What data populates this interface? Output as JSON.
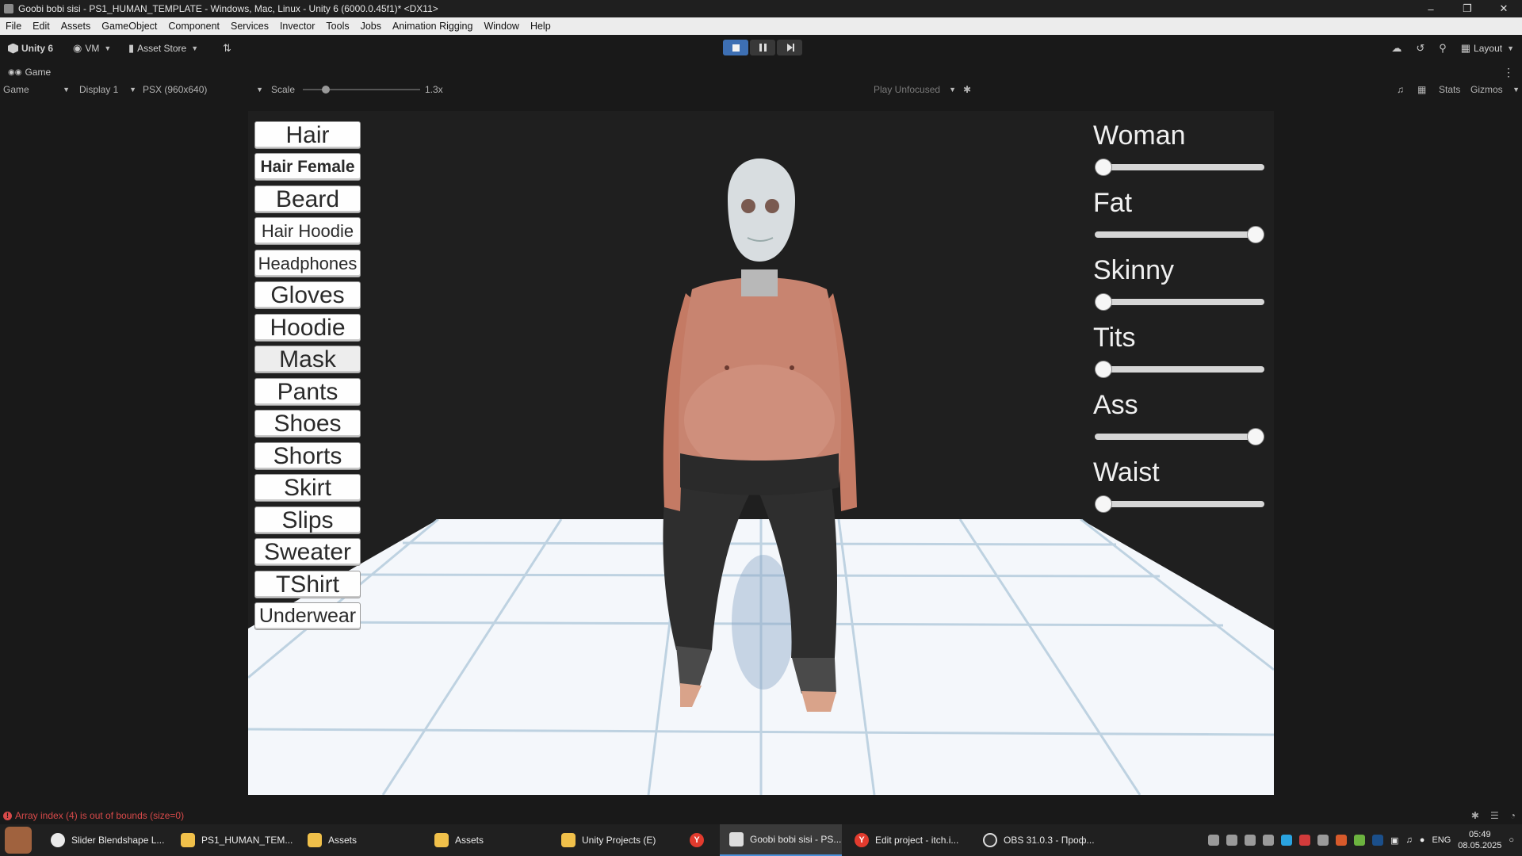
{
  "window": {
    "title": "Goobi bobi sisi - PS1_HUMAN_TEMPLATE - Windows, Mac, Linux - Unity 6 (6000.0.45f1)* <DX11>",
    "controls": [
      "–",
      "❐",
      "✕"
    ]
  },
  "menu": [
    "File",
    "Edit",
    "Assets",
    "GameObject",
    "Component",
    "Services",
    "Invector",
    "Tools",
    "Jobs",
    "Animation Rigging",
    "Window",
    "Help"
  ],
  "toolbar": {
    "unity_label": "Unity 6",
    "account": "VM",
    "asset_store": "Asset Store",
    "layout": "Layout",
    "play_state": "playing"
  },
  "game_tab": {
    "label": "Game"
  },
  "game_bar": {
    "view": "Game",
    "display": "Display 1",
    "resolution": "PSX (960x640)",
    "scale_label": "Scale",
    "scale_value": "1.3x",
    "play_mode": "Play Unfocused",
    "stats": "Stats",
    "gizmos": "Gizmos"
  },
  "clothing_buttons": [
    "Hair",
    "Hair Female",
    "Beard",
    "Hair Hoodie",
    "Headphones",
    "Gloves",
    "Hoodie",
    "Mask",
    "Pants",
    "Shoes",
    "Shorts",
    "Skirt",
    "Slips",
    "Sweater",
    "TShirt",
    "Underwear"
  ],
  "blendshape_sliders": [
    {
      "label": "Woman",
      "value": 0
    },
    {
      "label": "Fat",
      "value": 1
    },
    {
      "label": "Skinny",
      "value": 0
    },
    {
      "label": "Tits",
      "value": 0
    },
    {
      "label": "Ass",
      "value": 1
    },
    {
      "label": "Waist",
      "value": 0
    }
  ],
  "status": {
    "error": "Array index (4) is out of bounds (size=0)"
  },
  "taskbar": {
    "items": [
      {
        "label": "Slider Blendshape L...",
        "icon": "chatgpt-icon"
      },
      {
        "label": "PS1_HUMAN_TEM...",
        "icon": "folder-icon"
      },
      {
        "label": "Assets",
        "icon": "folder-icon"
      },
      {
        "label": "Assets",
        "icon": "folder-icon"
      },
      {
        "label": "Unity Projects (E)",
        "icon": "folder-icon"
      },
      {
        "label": "",
        "icon": "yandex-browser-icon"
      },
      {
        "label": "Goobi bobi sisi - PS...",
        "icon": "unity-icon"
      },
      {
        "label": "Edit project - itch.i...",
        "icon": "yandex-browser-icon"
      },
      {
        "label": "OBS 31.0.3 - Проф...",
        "icon": "obs-icon"
      }
    ],
    "language": "ENG",
    "time": "05:49",
    "date": "08.05.2025"
  }
}
